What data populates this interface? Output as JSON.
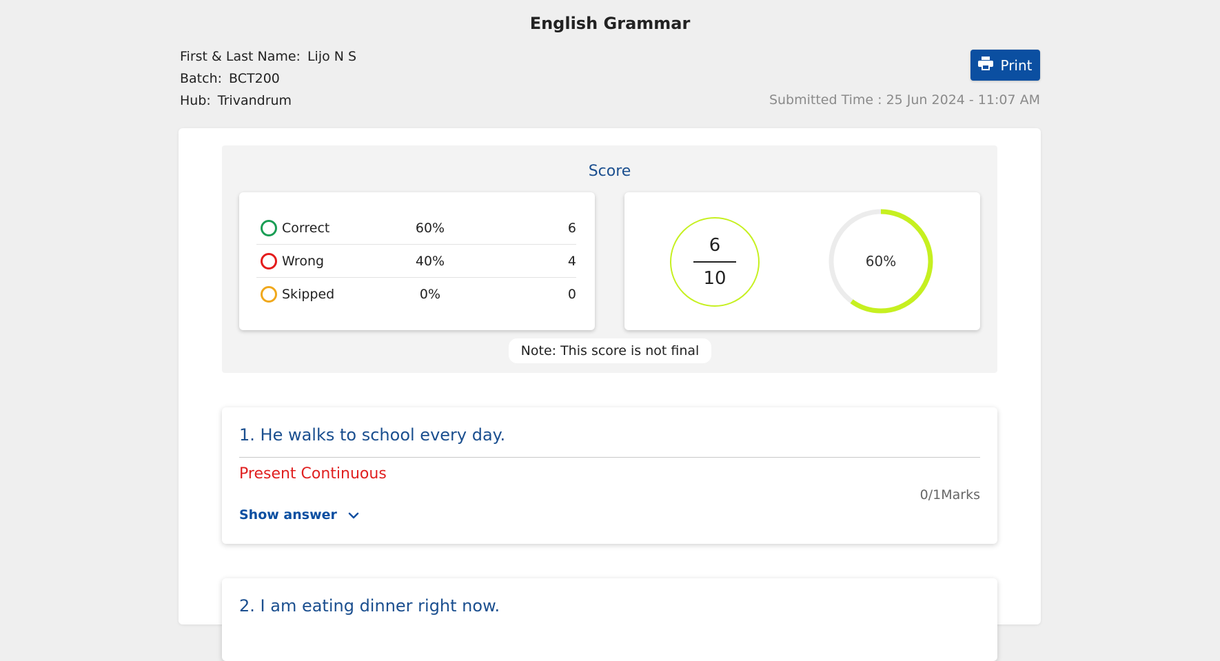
{
  "page": {
    "title": "English Grammar"
  },
  "student": {
    "name_label": "First & Last Name:",
    "name": "Lijo N S",
    "batch_label": "Batch:",
    "batch": "BCT200",
    "hub_label": "Hub:",
    "hub": "Trivandrum"
  },
  "toolbar": {
    "print_label": "Print"
  },
  "submitted": {
    "text": "Submitted Time : 25 Jun 2024 - 11:07 AM"
  },
  "score": {
    "title": "Score",
    "rows": [
      {
        "label": "Correct",
        "percent": "60%",
        "count": "6",
        "color": "#1a9e55"
      },
      {
        "label": "Wrong",
        "percent": "40%",
        "count": "4",
        "color": "#e41c1c"
      },
      {
        "label": "Skipped",
        "percent": "0%",
        "count": "0",
        "color": "#f0a81c"
      }
    ],
    "obtained": "6",
    "total": "10",
    "percent_label": "60%",
    "percent_value": 0.6,
    "accent": "#c6f020",
    "note": "Note: This score is not final"
  },
  "questions": [
    {
      "title": "1. He walks to school every day.",
      "answer": "Present Continuous",
      "marks": "0/1Marks",
      "show_answer": "Show answer"
    },
    {
      "title": "2. I am eating dinner right now."
    }
  ],
  "icons": {
    "print": "printer-icon",
    "expand": "chevron-down-icon"
  }
}
